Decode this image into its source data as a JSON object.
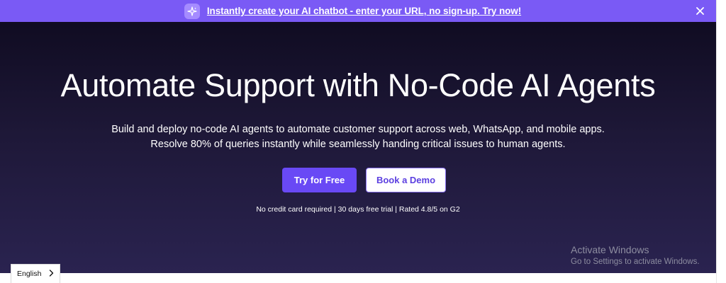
{
  "banner": {
    "icon": "sparkle-icon",
    "link_text": "Instantly create your AI chatbot - enter your URL, no sign-up. Try now!",
    "close_icon": "close-icon",
    "background": "#7a5af5"
  },
  "hero": {
    "title": "Automate Support with No-Code AI Agents",
    "subtitle_line1": "Build and deploy no-code AI agents to automate customer support across web, WhatsApp, and mobile apps.",
    "subtitle_line2": "Resolve 80% of queries instantly while seamlessly handing critical issues to human agents.",
    "primary_cta": "Try for Free",
    "secondary_cta": "Book a Demo",
    "trust_line": "No credit card required | 30 days free trial | Rated 4.8/5 on G2",
    "accent": "#6949f5"
  },
  "watermark": {
    "line1": "Activate Windows",
    "line2": "Go to Settings to activate Windows."
  },
  "language_selector": {
    "value": "English",
    "icon": "chevron-right-icon"
  }
}
